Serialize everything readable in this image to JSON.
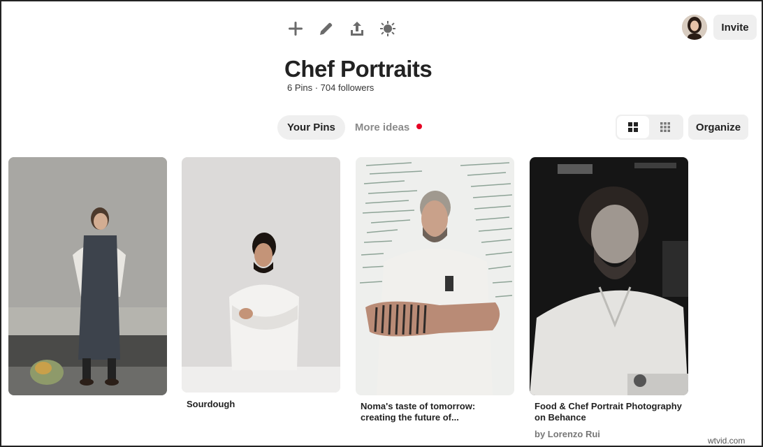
{
  "toolbar": {
    "icons": [
      "plus-icon",
      "pencil-icon",
      "share-icon",
      "sparkle-icon"
    ]
  },
  "header": {
    "invite_label": "Invite"
  },
  "board": {
    "title": "Chef Portraits",
    "meta": "6 Pins · 704 followers"
  },
  "tabs": {
    "your_pins": "Your Pins",
    "more_ideas": "More ideas"
  },
  "organize_label": "Organize",
  "pins": [
    {
      "title": "",
      "subtitle": ""
    },
    {
      "title": "Sourdough",
      "subtitle": ""
    },
    {
      "title": "Noma's taste of tomorrow: creating the future of...",
      "subtitle": ""
    },
    {
      "title": "Food & Chef Portrait Photography on Behance",
      "subtitle": "by Lorenzo Rui"
    }
  ],
  "watermark": "wtvid.com",
  "colors": {
    "accent_red": "#e60023",
    "button_gray": "#efefef"
  }
}
